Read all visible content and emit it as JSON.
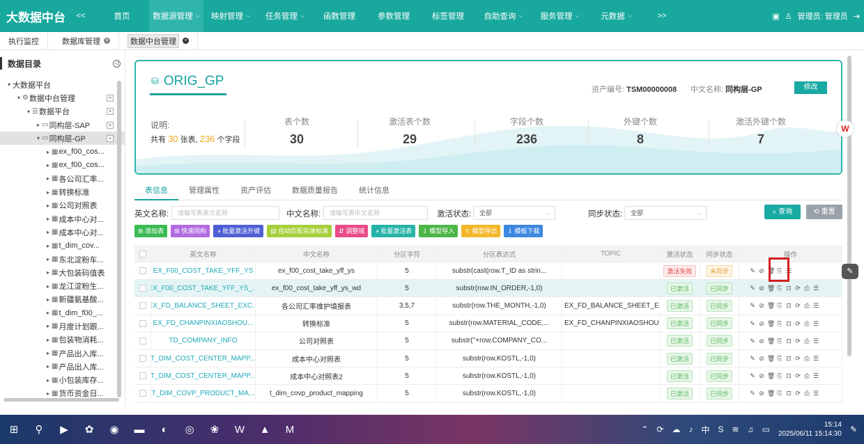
{
  "topnav": {
    "brand": "大数据中台",
    "collapse": "<<",
    "items": [
      {
        "label": "首页",
        "caret": false
      },
      {
        "label": "数据源管理",
        "caret": true
      },
      {
        "label": "映射管理",
        "caret": true
      },
      {
        "label": "任务管理",
        "caret": true
      },
      {
        "label": "函数管理",
        "caret": false
      },
      {
        "label": "参数管理",
        "caret": false
      },
      {
        "label": "标签管理",
        "caret": false
      },
      {
        "label": "自助查询",
        "caret": true
      },
      {
        "label": "服务管理",
        "caret": true
      },
      {
        "label": "元数据",
        "caret": true
      }
    ],
    "more": ">>",
    "user": "管理员: 管理员",
    "accent": "#18a89e"
  },
  "page_tabs": [
    {
      "label": "执行监控",
      "closable": false
    },
    {
      "label": "数据库管理",
      "closable": true
    },
    {
      "label": "数据中台管理",
      "closable": true,
      "active": true
    }
  ],
  "sidebar": {
    "title": "数据目录",
    "tree": [
      {
        "label": "大数据平台",
        "arrow": "▾",
        "icon": "",
        "plus": false
      },
      {
        "label": "数据中台管理",
        "arrow": "▾",
        "icon": "⚙",
        "plus": true
      },
      {
        "label": "数据平台",
        "arrow": "▾",
        "icon": "☰",
        "plus": true
      },
      {
        "label": "同构层-SAP",
        "arrow": "▸",
        "icon": "▭",
        "plus": true
      },
      {
        "label": "同构层-GP",
        "arrow": "▾",
        "icon": "▭",
        "plus": true,
        "selected": true
      },
      {
        "label": "ex_f00_cos...",
        "arrow": "▸",
        "icon": "▦",
        "plus": false
      },
      {
        "label": "ex_f00_cos...",
        "arrow": "▸",
        "icon": "▦",
        "plus": false
      },
      {
        "label": "各公司汇率...",
        "arrow": "▸",
        "icon": "▦",
        "plus": false
      },
      {
        "label": "转换标准",
        "arrow": "▸",
        "icon": "▦",
        "plus": false
      },
      {
        "label": "公司对照表",
        "arrow": "▸",
        "icon": "▦",
        "plus": false
      },
      {
        "label": "成本中心对...",
        "arrow": "▸",
        "icon": "▦",
        "plus": false
      },
      {
        "label": "成本中心对...",
        "arrow": "▸",
        "icon": "▦",
        "plus": false
      },
      {
        "label": "t_dim_cov...",
        "arrow": "▸",
        "icon": "▦",
        "plus": false
      },
      {
        "label": "东北淀粉车...",
        "arrow": "▸",
        "icon": "▦",
        "plus": false
      },
      {
        "label": "大包装码值表",
        "arrow": "▸",
        "icon": "▦",
        "plus": false
      },
      {
        "label": "龙江淀粉生...",
        "arrow": "▸",
        "icon": "▦",
        "plus": false
      },
      {
        "label": "新疆氨基酸...",
        "arrow": "▸",
        "icon": "▦",
        "plus": false
      },
      {
        "label": "t_dim_f00_...",
        "arrow": "▸",
        "icon": "▦",
        "plus": false
      },
      {
        "label": "月度计划跟...",
        "arrow": "▸",
        "icon": "▦",
        "plus": false
      },
      {
        "label": "包装物消耗...",
        "arrow": "▸",
        "icon": "▦",
        "plus": false
      },
      {
        "label": "产品出入库...",
        "arrow": "▸",
        "icon": "▦",
        "plus": false
      },
      {
        "label": "产品出入库...",
        "arrow": "▸",
        "icon": "▦",
        "plus": false
      },
      {
        "label": "小包装库存...",
        "arrow": "▸",
        "icon": "▦",
        "plus": false
      },
      {
        "label": "货币资金日...",
        "arrow": "▸",
        "icon": "▦",
        "plus": false
      }
    ]
  },
  "summary": {
    "title": "ORIG_GP",
    "asset_label": "资产编号:",
    "asset_value": "TSM00000008",
    "cname_label": "中文名称:",
    "cname_value": "同构层-GP",
    "edit": "修改",
    "desc_label": "说明:",
    "desc_pre": "共有",
    "desc_tables": "30",
    "desc_mid": "张表,",
    "desc_fields": "236",
    "desc_post": "个字段",
    "stats": [
      {
        "label": "表个数",
        "value": "30"
      },
      {
        "label": "激活表个数",
        "value": "29"
      },
      {
        "label": "字段个数",
        "value": "236"
      },
      {
        "label": "外键个数",
        "value": "8"
      },
      {
        "label": "激活外键个数",
        "value": "7"
      }
    ]
  },
  "content_tabs": [
    "表信息",
    "管理属性",
    "资产评估",
    "数据质量报告",
    "统计信息"
  ],
  "filters": {
    "en_label": "英文名称:",
    "en_placeholder": "请输写表英文名称",
    "cn_label": "中文名称:",
    "cn_placeholder": "请输写表中文名称",
    "act_label": "激活状态:",
    "act_value": "全部",
    "sync_label": "同步状态:",
    "sync_value": "全部",
    "query": "查询",
    "reset": "重置"
  },
  "actions": [
    {
      "label": "添加表",
      "icon": "⊞",
      "color": "#3cba54"
    },
    {
      "label": "快速同构",
      "icon": "⊞",
      "color": "#b26be0"
    },
    {
      "label": "批量激活外键",
      "icon": "◑",
      "color": "#4e5fd6"
    },
    {
      "label": "自动匹配实体标准",
      "icon": "▤",
      "color": "#a6cf3b"
    },
    {
      "label": "调整域",
      "icon": "⇵",
      "color": "#ea4c89"
    },
    {
      "label": "批量激活表",
      "icon": "◑",
      "color": "#27b3a8"
    },
    {
      "label": "模型导入",
      "icon": "⇩",
      "color": "#4cb648"
    },
    {
      "label": "模型导出",
      "icon": "⇧",
      "color": "#f3b72a"
    },
    {
      "label": "模板下载",
      "icon": "⇩",
      "color": "#3c88e0"
    }
  ],
  "table": {
    "headers": [
      "英文名称",
      "中文名称",
      "分区字符",
      "分区表达式",
      "TOPIC",
      "激活状态",
      "同步状态",
      "操作"
    ],
    "rows": [
      {
        "en": "EX_F00_COST_TAKE_YFF_YS",
        "cn": "ex_f00_cost_take_yff_ys",
        "part": "5",
        "expr": "substr(cast(row.T_ID as strin...",
        "topic": "",
        "active": "激活失败",
        "active_kind": "fail",
        "sync": "未同步",
        "sync_kind": "warn"
      },
      {
        "en": "EX_F00_COST_TAKE_YFF_YS_...",
        "cn": "ex_f00_cost_take_yff_ys_wd",
        "part": "5",
        "expr": "substr(row.IN_ORDER,-1,0)",
        "topic": "",
        "active": "已激活",
        "active_kind": "ok",
        "sync": "已同步",
        "sync_kind": "ok"
      },
      {
        "en": "EX_FD_BALANCE_SHEET_EXC...",
        "cn": "各公司汇率维护填报表",
        "part": "3,5,7",
        "expr": "substr(row.THE_MONTH,-1,0)",
        "topic": "EX_FD_BALANCE_SHEET_EX...",
        "active": "已激活",
        "active_kind": "ok",
        "sync": "已同步",
        "sync_kind": "ok"
      },
      {
        "en": "EX_FD_CHANPINXIAOSHOU...",
        "cn": "转换标准",
        "part": "5",
        "expr": "substr(row.MATERIAL_CODE,...",
        "topic": "EX_FD_CHANPINXIAOSHOU...",
        "active": "已激活",
        "active_kind": "ok",
        "sync": "已同步",
        "sync_kind": "ok"
      },
      {
        "en": "TD_COMPANY_INFO",
        "cn": "公司对照表",
        "part": "5",
        "expr": "substr(''+row.COMPANY_CO...",
        "topic": "",
        "active": "已激活",
        "active_kind": "ok",
        "sync": "已同步",
        "sync_kind": "ok"
      },
      {
        "en": "T_DIM_COST_CENTER_MAPP...",
        "cn": "成本中心对照表",
        "part": "5",
        "expr": "substr(row.KOSTL,-1,0)",
        "topic": "",
        "active": "已激活",
        "active_kind": "ok",
        "sync": "已同步",
        "sync_kind": "ok"
      },
      {
        "en": "T_DIM_COST_CENTER_MAPP...",
        "cn": "成本中心对照表2",
        "part": "5",
        "expr": "substr(row.KOSTL,-1,0)",
        "topic": "",
        "active": "已激活",
        "active_kind": "ok",
        "sync": "已同步",
        "sync_kind": "ok"
      },
      {
        "en": "T_DIM_COVP_PRODUCT_MA...",
        "cn": "t_dim_covp_product_mapping",
        "part": "5",
        "expr": "substr(row.KOSTL,-1,0)",
        "topic": "",
        "active": "已激活",
        "active_kind": "ok",
        "sync": "已同步",
        "sync_kind": "ok"
      }
    ]
  },
  "taskbar": {
    "time": "15:14",
    "datetime": "2025/06/11 15:14:30",
    "ime": "中"
  }
}
